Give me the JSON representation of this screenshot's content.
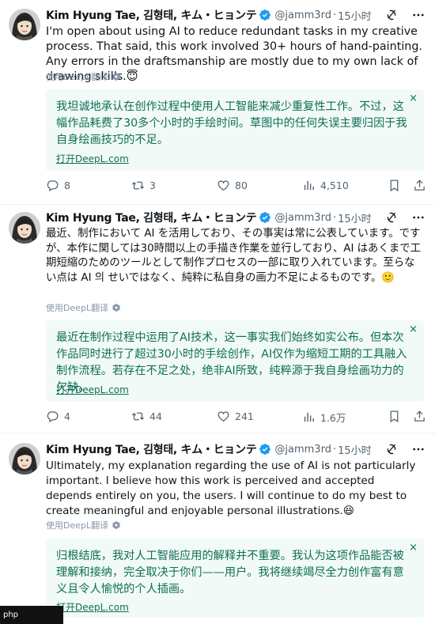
{
  "tweets": [
    {
      "author_name": "Kim Hyung Tae, 김형태, キム・ヒョンテ",
      "handle": "@jamm3rd",
      "dot": "·",
      "time": "15小时",
      "text": "I'm open about using AI to reduce redundant tasks in my creative process. That said, this work involved 30+ hours of hand-painting. Any errors in the draftsmanship are mostly due to my own lack of drawing skills.😇",
      "deepl_tag": "使用DeepL翻译",
      "translation": "我坦诚地承认在创作过程中使用人工智能来减少重复性工作。不过，这幅作品耗费了30多个小时的手绘时间。草图中的任何失误主要归因于我自身绘画技巧的不足。",
      "translation_link": "打开DeepL.com",
      "close": "×",
      "replies": "8",
      "retweets": "3",
      "likes": "80",
      "views": "4,510"
    },
    {
      "author_name": "Kim Hyung Tae, 김형태, キム・ヒョンテ",
      "handle": "@jamm3rd",
      "dot": "·",
      "time": "15小时",
      "text": "最近、制作において AI を活用しており、その事実は常に公表しています。ですが、本作に関しては30時間以上の手描き作業を並行しており、AI はあくまで工期短縮のためのツールとして制作プロセスの一部に取り入れています。至らない点は AI 의 せいではなく、純粋に私自身の画力不足によるものです。🙂",
      "deepl_tag": "使用DeepL翻译",
      "translation": "最近在制作过程中运用了AI技术，这一事实我们始终如实公布。但本次作品同时进行了超过30小时的手绘创作，AI仅作为缩短工期的工具融入制作流程。若存在不足之处，绝非AI所致，纯粹源于我自身绘画功力的欠缺。",
      "translation_link": "打开DeepL.com",
      "close": "×",
      "replies": "4",
      "retweets": "44",
      "likes": "241",
      "views": "1.6万"
    },
    {
      "author_name": "Kim Hyung Tae, 김형태, キム・ヒョンテ",
      "handle": "@jamm3rd",
      "dot": "·",
      "time": "15小时",
      "text": "Ultimately, my explanation regarding the use of AI is not particularly important. I believe how this work is perceived and accepted depends entirely on you, the users. I will continue to do my best to create meaningful and enjoyable personal illustrations.😆",
      "deepl_tag": "使用DeepL翻译",
      "translation": "归根结底，我对人工智能应用的解释并不重要。我认为这项作品能否被理解和接纳，完全取决于你们——用户。我将继续竭尽全力创作富有意义且令人愉悦的个人插画。",
      "translation_link": "打开DeepL.com",
      "close": "×"
    }
  ],
  "icons": {
    "verified": "verified-badge-icon",
    "grok": "grok-icon",
    "more": "more-icon",
    "reply": "reply-icon",
    "retweet": "retweet-icon",
    "like": "like-icon",
    "views": "views-icon",
    "bookmark": "bookmark-icon",
    "share": "share-icon",
    "deepl": "deepl-icon"
  },
  "colors": {
    "verified_blue": "#1d9bf0",
    "translation_green": "#0f6e56",
    "translation_bg": "#f1faf7",
    "secondary_text": "#536471"
  },
  "watermark": "php"
}
